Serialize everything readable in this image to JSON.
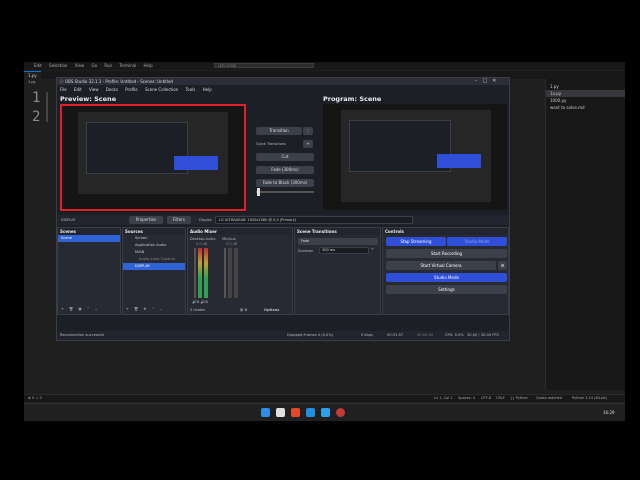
{
  "vscode": {
    "menu": [
      "Edit",
      "Selection",
      "View",
      "Go",
      "Run",
      "Terminal",
      "Help"
    ],
    "search_placeholder": "LED CODE",
    "tabs": [
      "1.py",
      "1.py"
    ],
    "line_numbers": [
      "1",
      "2"
    ],
    "explorer_items": [
      "1.py",
      "1a.py",
      "1000.py",
      "want to solve.md"
    ],
    "status_left": "⊗ 0 ⚠ 0",
    "status_right_items": [
      "Ln 1, Col 1",
      "Spaces: 4",
      "UTF-8",
      "CRLF",
      "{} Python",
      "Quota reached",
      "Python 3.14 (64-bit)"
    ],
    "clock": "16:29"
  },
  "obs": {
    "title": "OBS Studio 32.1.1 - Profile: Untitled - Scenes: Untitled",
    "menu": [
      "File",
      "Edit",
      "View",
      "Docks",
      "Profile",
      "Scene Collection",
      "Tools",
      "Help"
    ],
    "preview_label": "Preview: Scene",
    "program_label": "Program: Scene",
    "transition_button": "Transition",
    "quick_transitions_label": "Quick Transitions",
    "cut": "Cut",
    "fade": "Fade (300ms)",
    "fade_black": "Fade to Black (300ms)",
    "source_bar": {
      "source_name": "DISPLAY",
      "properties": "Properties",
      "filters": "Filters",
      "display_label": "Display",
      "display_value": "LG ULTRAGEAR: 1920x1080 @ 0,0 (Primary)"
    },
    "scenes": {
      "title": "Scenes",
      "items": [
        "Scene"
      ]
    },
    "sources": {
      "title": "Sources",
      "items": [
        "Screen",
        "Application Audio",
        "MAIN",
        "Audio Input Capture",
        "DISPLAY"
      ]
    },
    "mixer": {
      "title": "Audio Mixer",
      "channels": [
        "Desktop Audio",
        "Mic/Aux"
      ],
      "levels": [
        "0.0 dB",
        "0.0 dB"
      ],
      "hidden": "0 hidden"
    },
    "transitions": {
      "title": "Scene Transitions",
      "type": "Fade",
      "duration_label": "Duration",
      "duration_value": "300 ms"
    },
    "controls": {
      "title": "Controls",
      "stop_streaming": "Stop Streaming",
      "studio_mode_side": "Studio Mode",
      "start_recording": "Start Recording",
      "start_virtual_camera": "Start Virtual Camera",
      "studio_mode": "Studio Mode",
      "settings": "Settings"
    },
    "options": "Options",
    "status": {
      "left": "Reconnection successful",
      "dropped": "Dropped Frames 0 (0.0%)",
      "kbps": "0 kbps",
      "time": "00:31:57",
      "rec": "00:00:00",
      "cpu": "CPU: 0.0%",
      "fps": "30.00 / 30.00 FPS"
    }
  },
  "colors": {
    "accent": "#2f4fd8",
    "preview_border": "#e0202a",
    "selection": "#2f64d6"
  }
}
